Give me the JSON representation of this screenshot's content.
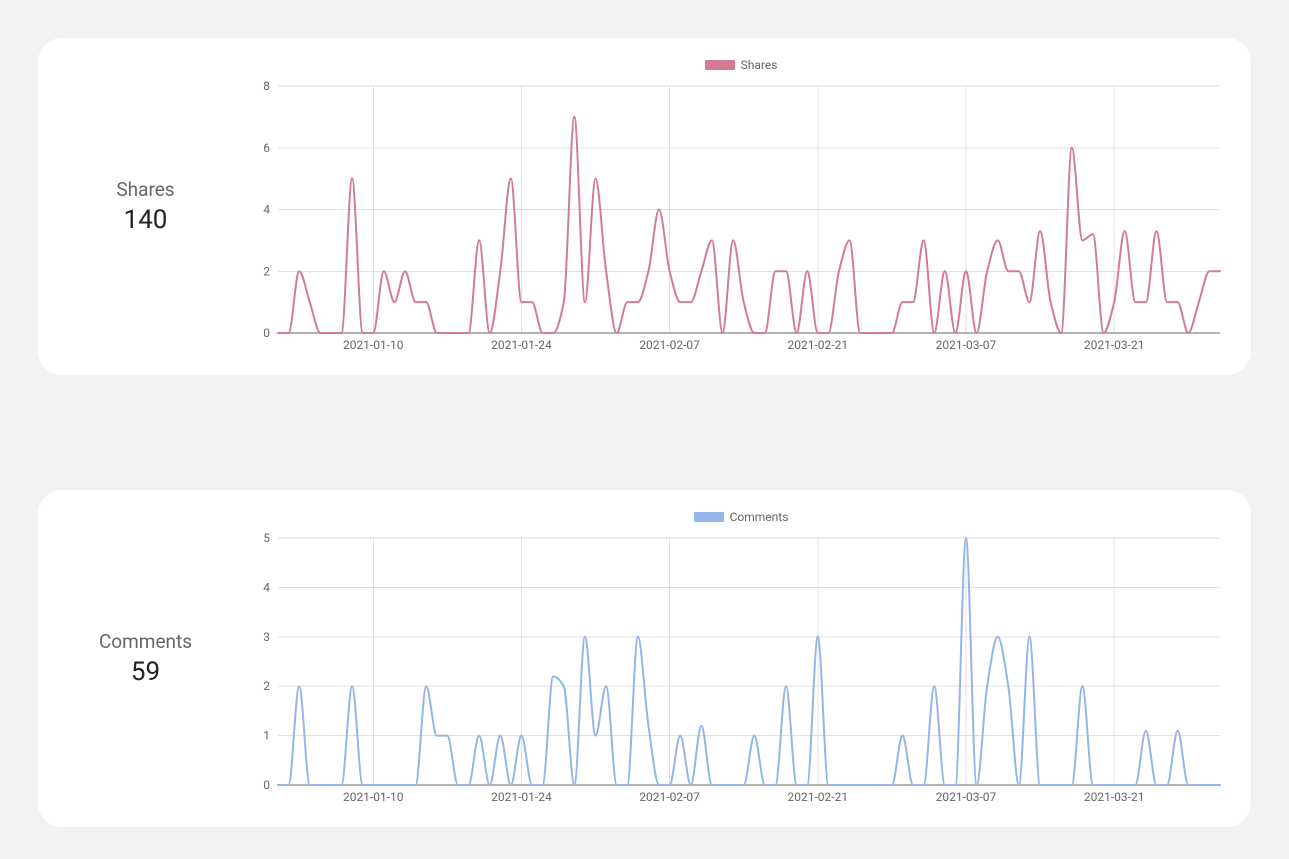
{
  "cards": [
    {
      "key": "shares",
      "name": "Shares",
      "value": "140",
      "legend": "Shares",
      "color": "#d47b94"
    },
    {
      "key": "comments",
      "name": "Comments",
      "value": "59",
      "legend": "Comments",
      "color": "#94b5e8"
    }
  ],
  "chart_data": [
    {
      "type": "line",
      "title": "",
      "legend": [
        "Shares"
      ],
      "color": "#d47b94",
      "xlabel": "",
      "ylabel": "",
      "ylim": [
        0,
        8
      ],
      "yticks": [
        0,
        2,
        4,
        6,
        8
      ],
      "x_tick_labels": [
        "2021-01-10",
        "2021-01-24",
        "2021-02-07",
        "2021-02-21",
        "2021-03-07",
        "2021-03-21"
      ],
      "x": [
        "2021-01-01",
        "2021-01-02",
        "2021-01-03",
        "2021-01-04",
        "2021-01-05",
        "2021-01-06",
        "2021-01-07",
        "2021-01-08",
        "2021-01-09",
        "2021-01-10",
        "2021-01-11",
        "2021-01-12",
        "2021-01-13",
        "2021-01-14",
        "2021-01-15",
        "2021-01-16",
        "2021-01-17",
        "2021-01-18",
        "2021-01-19",
        "2021-01-20",
        "2021-01-21",
        "2021-01-22",
        "2021-01-23",
        "2021-01-24",
        "2021-01-25",
        "2021-01-26",
        "2021-01-27",
        "2021-01-28",
        "2021-01-29",
        "2021-01-30",
        "2021-01-31",
        "2021-02-01",
        "2021-02-02",
        "2021-02-03",
        "2021-02-04",
        "2021-02-05",
        "2021-02-06",
        "2021-02-07",
        "2021-02-08",
        "2021-02-09",
        "2021-02-10",
        "2021-02-11",
        "2021-02-12",
        "2021-02-13",
        "2021-02-14",
        "2021-02-15",
        "2021-02-16",
        "2021-02-17",
        "2021-02-18",
        "2021-02-19",
        "2021-02-20",
        "2021-02-21",
        "2021-02-22",
        "2021-02-23",
        "2021-02-24",
        "2021-02-25",
        "2021-02-26",
        "2021-02-27",
        "2021-02-28",
        "2021-03-01",
        "2021-03-02",
        "2021-03-03",
        "2021-03-04",
        "2021-03-05",
        "2021-03-06",
        "2021-03-07",
        "2021-03-08",
        "2021-03-09",
        "2021-03-10",
        "2021-03-11",
        "2021-03-12",
        "2021-03-13",
        "2021-03-14",
        "2021-03-15",
        "2021-03-16",
        "2021-03-17",
        "2021-03-18",
        "2021-03-19",
        "2021-03-20",
        "2021-03-21",
        "2021-03-22",
        "2021-03-23",
        "2021-03-24",
        "2021-03-25",
        "2021-03-26",
        "2021-03-27",
        "2021-03-28",
        "2021-03-29",
        "2021-03-30",
        "2021-03-31"
      ],
      "values": [
        0,
        0,
        2,
        1,
        0,
        0,
        0,
        5,
        0,
        0,
        2,
        1,
        2,
        1,
        1,
        0,
        0,
        0,
        0,
        3,
        0,
        2,
        5,
        1,
        1,
        0,
        0,
        1,
        7,
        1,
        5,
        2,
        0,
        1,
        1,
        2,
        4,
        2,
        1,
        1,
        2,
        3,
        0,
        3,
        1,
        0,
        0,
        2,
        2,
        0,
        2,
        0,
        0,
        2,
        3,
        0,
        0,
        0,
        0,
        1,
        1,
        3,
        0,
        2,
        0,
        2,
        0,
        2,
        3,
        2,
        2,
        1,
        3.3,
        1,
        0,
        6,
        3,
        3.2,
        0,
        1,
        3.3,
        1,
        1,
        3.3,
        1,
        1,
        0,
        1,
        2,
        2
      ]
    },
    {
      "type": "line",
      "title": "",
      "legend": [
        "Comments"
      ],
      "color": "#94b5e8",
      "xlabel": "",
      "ylabel": "",
      "ylim": [
        0,
        5
      ],
      "yticks": [
        0,
        1,
        2,
        3,
        4,
        5
      ],
      "x_tick_labels": [
        "2021-01-10",
        "2021-01-24",
        "2021-02-07",
        "2021-02-21",
        "2021-03-07",
        "2021-03-21"
      ],
      "x": [
        "2021-01-01",
        "2021-01-02",
        "2021-01-03",
        "2021-01-04",
        "2021-01-05",
        "2021-01-06",
        "2021-01-07",
        "2021-01-08",
        "2021-01-09",
        "2021-01-10",
        "2021-01-11",
        "2021-01-12",
        "2021-01-13",
        "2021-01-14",
        "2021-01-15",
        "2021-01-16",
        "2021-01-17",
        "2021-01-18",
        "2021-01-19",
        "2021-01-20",
        "2021-01-21",
        "2021-01-22",
        "2021-01-23",
        "2021-01-24",
        "2021-01-25",
        "2021-01-26",
        "2021-01-27",
        "2021-01-28",
        "2021-01-29",
        "2021-01-30",
        "2021-01-31",
        "2021-02-01",
        "2021-02-02",
        "2021-02-03",
        "2021-02-04",
        "2021-02-05",
        "2021-02-06",
        "2021-02-07",
        "2021-02-08",
        "2021-02-09",
        "2021-02-10",
        "2021-02-11",
        "2021-02-12",
        "2021-02-13",
        "2021-02-14",
        "2021-02-15",
        "2021-02-16",
        "2021-02-17",
        "2021-02-18",
        "2021-02-19",
        "2021-02-20",
        "2021-02-21",
        "2021-02-22",
        "2021-02-23",
        "2021-02-24",
        "2021-02-25",
        "2021-02-26",
        "2021-02-27",
        "2021-02-28",
        "2021-03-01",
        "2021-03-02",
        "2021-03-03",
        "2021-03-04",
        "2021-03-05",
        "2021-03-06",
        "2021-03-07",
        "2021-03-08",
        "2021-03-09",
        "2021-03-10",
        "2021-03-11",
        "2021-03-12",
        "2021-03-13",
        "2021-03-14",
        "2021-03-15",
        "2021-03-16",
        "2021-03-17",
        "2021-03-18",
        "2021-03-19",
        "2021-03-20",
        "2021-03-21",
        "2021-03-22",
        "2021-03-23",
        "2021-03-24",
        "2021-03-25",
        "2021-03-26",
        "2021-03-27",
        "2021-03-28",
        "2021-03-29",
        "2021-03-30",
        "2021-03-31"
      ],
      "values": [
        0,
        0,
        2,
        0,
        0,
        0,
        0,
        2,
        0,
        0,
        0,
        0,
        0,
        0,
        2,
        1,
        1,
        0,
        0,
        1,
        0,
        1,
        0,
        1,
        0,
        0,
        2.2,
        2,
        0,
        3,
        1,
        2,
        0,
        0,
        3,
        1.2,
        0,
        0,
        1,
        0,
        1.2,
        0,
        0,
        0,
        0,
        1,
        0,
        0,
        2,
        0,
        0,
        3,
        0,
        0,
        0,
        0,
        0,
        0,
        0,
        1,
        0,
        0,
        2,
        0,
        0,
        5,
        0,
        2,
        3,
        2,
        0,
        3,
        0,
        0,
        0,
        0,
        2,
        0,
        0,
        0,
        0,
        0,
        1.1,
        0,
        0,
        1.1,
        0,
        0,
        0,
        0
      ]
    }
  ]
}
